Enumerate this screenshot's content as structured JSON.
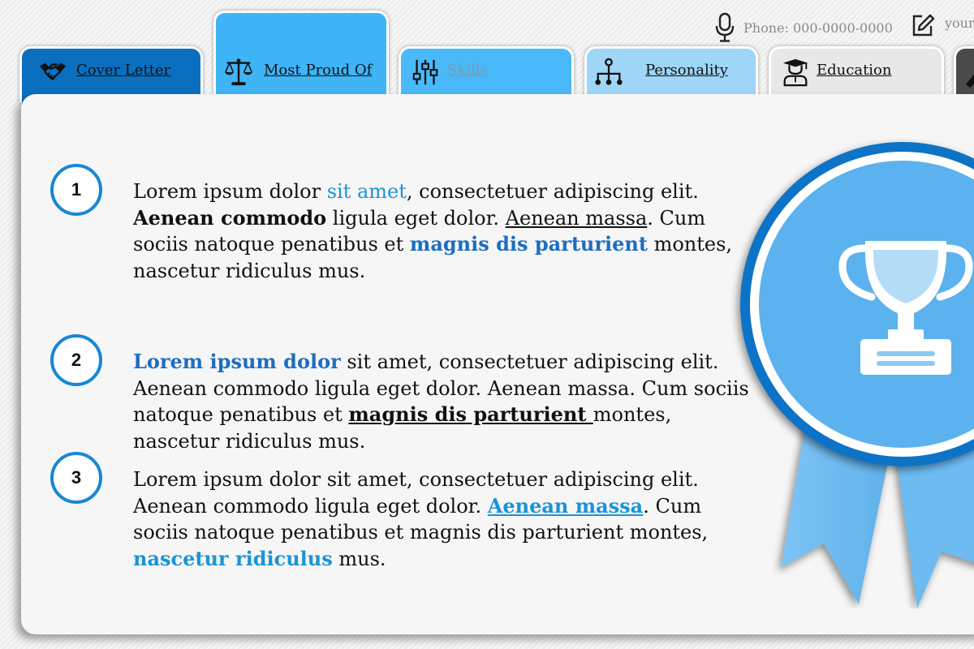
{
  "header": {
    "phone": "Phone: 000-0000-0000",
    "email": "your",
    "icons": {
      "mic": "microphone-icon",
      "edit": "edit-icon"
    }
  },
  "tabs": [
    {
      "id": "cover",
      "label": "Cover Letter",
      "icon": "handshake-icon",
      "color": "#0b6fbf"
    },
    {
      "id": "proud",
      "label": "Most Proud Of",
      "icon": "scales-icon",
      "color": "#3fb4f7",
      "active": true
    },
    {
      "id": "skills",
      "label": "Skills",
      "icon": "sliders-icon",
      "color": "#4ab9f9"
    },
    {
      "id": "personality",
      "label": "Personality",
      "icon": "hierarchy-icon",
      "color": "#9fd5f7"
    },
    {
      "id": "education",
      "label": "Education",
      "icon": "graduate-icon",
      "color": "#e8e8e8"
    },
    {
      "id": "more",
      "label": "",
      "icon": "tool-icon",
      "color": "#4a4a4a"
    }
  ],
  "items": [
    {
      "number": "1",
      "p1": "Lorem ipsum dolor ",
      "link1": "sit amet",
      "p2": ", consectetuer adipiscing elit.",
      "bold1": "Aenean commodo",
      "p3": " ligula eget dolor. ",
      "under1": "Aenean massa",
      "p4": ". Cum sociis natoque penatibus et ",
      "link2": "magnis dis parturient",
      "p5": " montes, nascetur ridiculus mus."
    },
    {
      "number": "2",
      "link1": "Lorem ipsum dolor",
      "p1": " sit amet, consectetuer adipiscing elit. Aenean commodo ligula eget dolor. Aenean massa. Cum sociis natoque penatibus et ",
      "bold1": "magnis dis parturient ",
      "p2": "montes, nascetur ridiculus mus."
    },
    {
      "number": "3",
      "p1": "Lorem ipsum dolor sit amet, consectetuer adipiscing elit. Aenean commodo ligula eget dolor. ",
      "link1": "Aenean massa",
      "p2": ". Cum sociis natoque penatibus et magnis dis parturient montes, ",
      "link2": "nascetur ridiculus",
      "p3": " mus."
    }
  ],
  "badge": {
    "icon": "trophy-icon",
    "accent": "#0b73c6",
    "fill": "#5bb2ee"
  }
}
